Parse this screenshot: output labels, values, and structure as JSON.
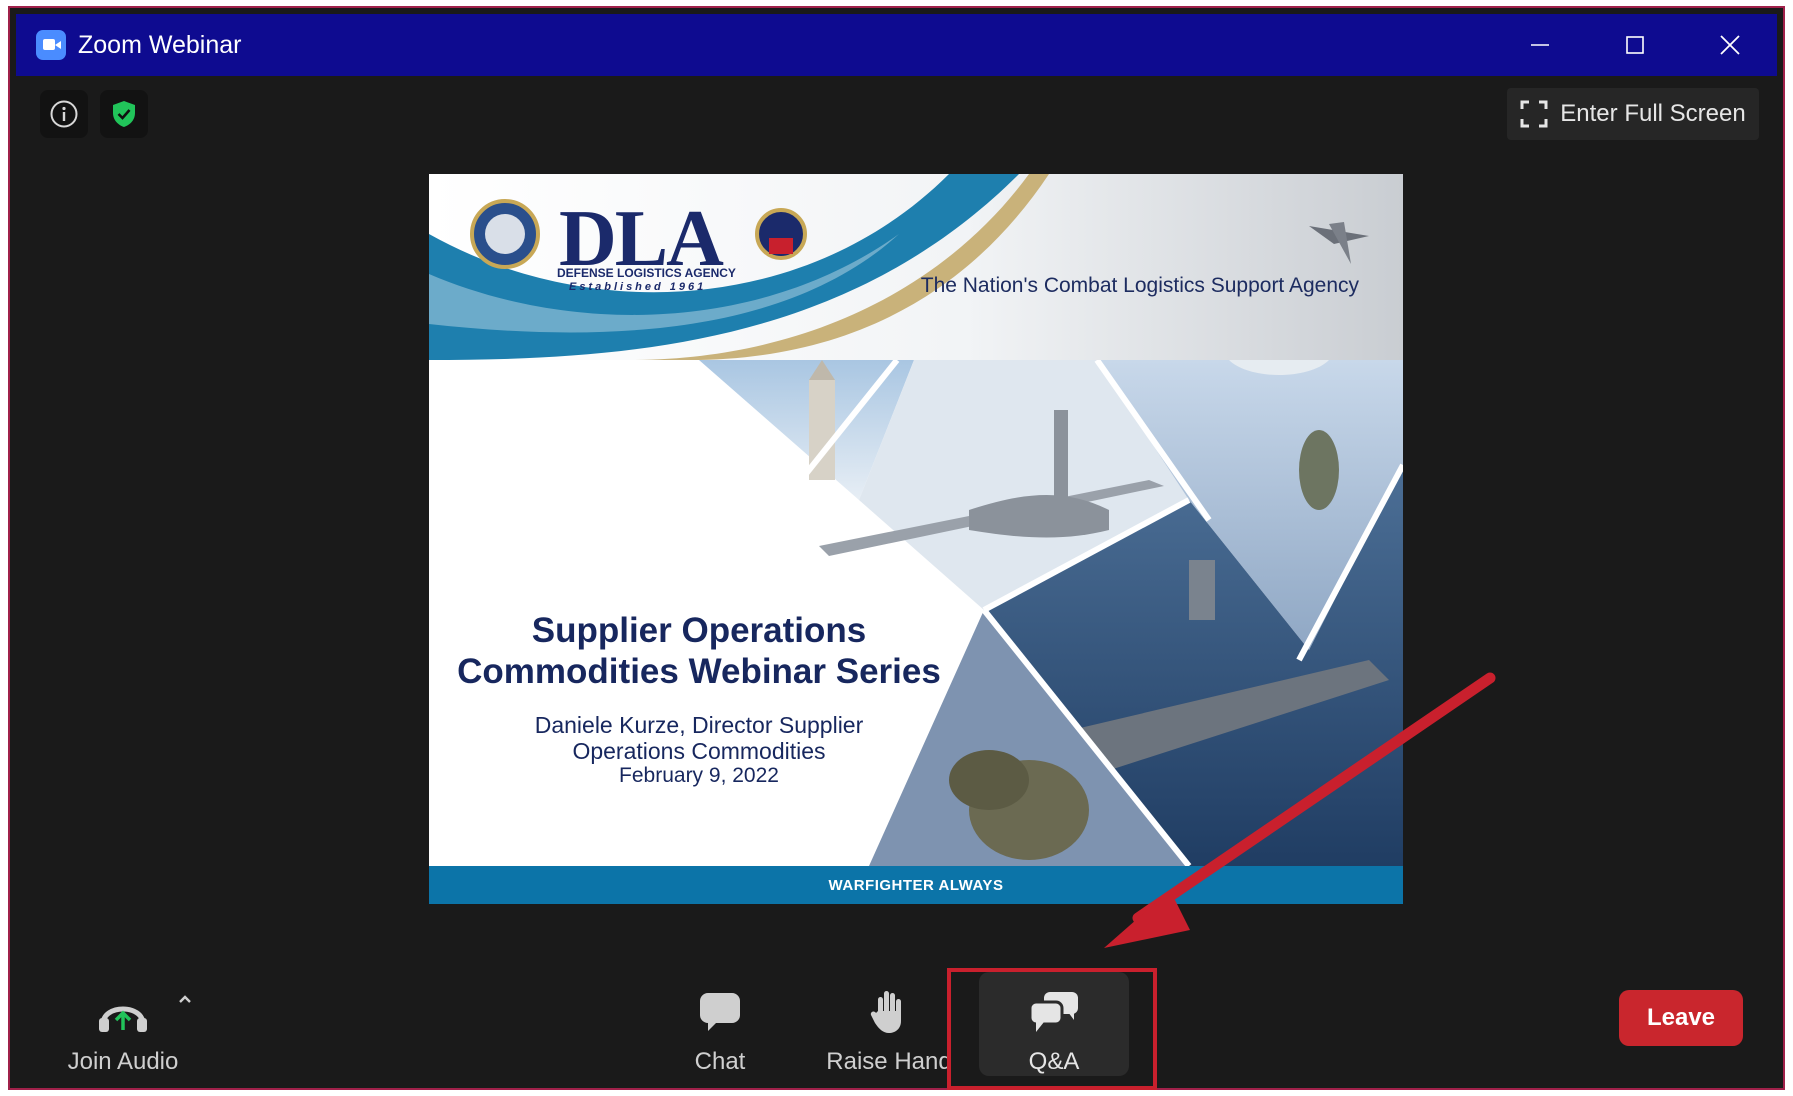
{
  "window": {
    "title": "Zoom Webinar",
    "fullscreen_label": "Enter Full Screen"
  },
  "slide": {
    "logo_text": "DLA",
    "logo_subtitle": "DEFENSE LOGISTICS AGENCY",
    "logo_established": "Established 1961",
    "tagline": "The Nation's Combat Logistics Support Agency",
    "title_line1": "Supplier Operations",
    "title_line2": "Commodities Webinar Series",
    "presenter_line1": "Daniele Kurze, Director Supplier",
    "presenter_line2": "Operations Commodities",
    "date": "February 9, 2022",
    "footer": "WARFIGHTER ALWAYS"
  },
  "toolbar": {
    "join_audio": "Join Audio",
    "chat": "Chat",
    "raise_hand": "Raise Hand",
    "qa": "Q&A",
    "leave": "Leave"
  },
  "colors": {
    "titlebar": "#0e0b90",
    "leave": "#c9262d",
    "highlight": "#c9202d",
    "slide_footer": "#0c74a8",
    "slide_navy": "#17275e"
  }
}
